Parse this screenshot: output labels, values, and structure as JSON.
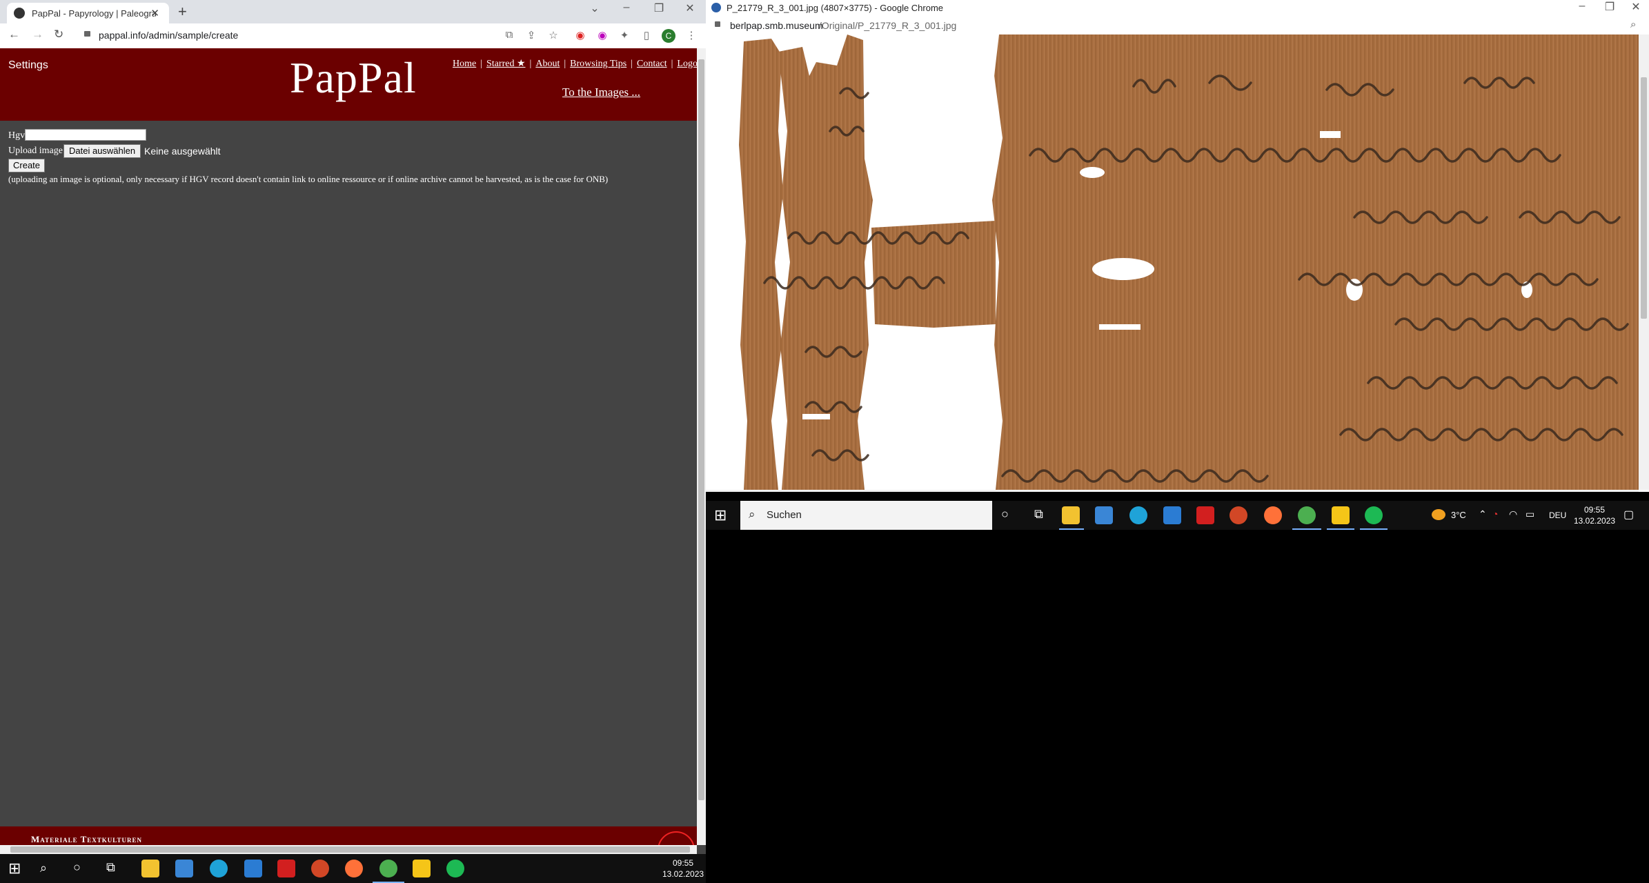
{
  "left_browser": {
    "tab_title": "PapPal - Papyrology | Paleograph",
    "url": "pappal.info/admin/sample/create",
    "profile_initial": "C"
  },
  "site": {
    "settings_label": "Settings",
    "brand": "PapPal",
    "nav": [
      {
        "label": "Home"
      },
      {
        "label": "Starred ★"
      },
      {
        "label": "About"
      },
      {
        "label": "Browsing Tips"
      },
      {
        "label": "Contact"
      },
      {
        "label": "Logou"
      }
    ],
    "to_images": "To the Images ..."
  },
  "form": {
    "hgv_label": "Hgv",
    "hgv_value": "",
    "upload_label": "Upload image",
    "file_button": "Datei auswählen",
    "no_file": "Keine ausgewählt",
    "create_button": "Create",
    "note": "(uploading an image is optional, only necessary if HGV record doesn't contain link to online ressource or if online archive cannot be harvested, as is the case for ONB)"
  },
  "footer": {
    "text": "Materiale Textkulturen"
  },
  "right_browser": {
    "window_title": "P_21779_R_3_001.jpg (4807×3775) - Google Chrome",
    "url_domain": "berlpap.smb.museum",
    "url_path": "/Original/P_21779_R_3_001.jpg"
  },
  "taskbar_bottom": {
    "time": "09:55",
    "date": "13.02.2023"
  },
  "taskbar_right": {
    "search_placeholder": "Suchen",
    "weather": "3°C",
    "language": "DEU",
    "time": "09:55",
    "date": "13.02.2023"
  },
  "colors": {
    "header_red": "#6b0000",
    "page_bg": "#444444",
    "papyrus": "#a86e40"
  }
}
